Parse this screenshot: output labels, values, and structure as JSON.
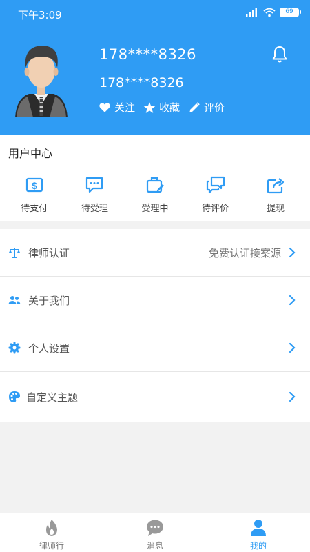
{
  "status_bar": {
    "time": "下午3:09",
    "battery": "69"
  },
  "profile": {
    "phone_primary": "178****8326",
    "phone_secondary": "178****8326",
    "actions": [
      {
        "label": "关注",
        "icon": "heart-icon"
      },
      {
        "label": "收藏",
        "icon": "star-icon"
      },
      {
        "label": "评价",
        "icon": "pencil-icon"
      }
    ]
  },
  "user_center": {
    "title": "用户中心",
    "items": [
      {
        "label": "待支付",
        "icon": "dollar-icon"
      },
      {
        "label": "待受理",
        "icon": "message-icon"
      },
      {
        "label": "受理中",
        "icon": "briefcase-icon"
      },
      {
        "label": "待评价",
        "icon": "chat-icon"
      },
      {
        "label": "提现",
        "icon": "share-icon"
      }
    ]
  },
  "menu": [
    {
      "label": "律师认证",
      "hint": "免费认证接案源",
      "icon": "scale-icon"
    },
    {
      "label": "关于我们",
      "hint": "",
      "icon": "people-icon"
    },
    {
      "label": "个人设置",
      "hint": "",
      "icon": "gear-icon"
    },
    {
      "label": "自定义主题",
      "hint": "",
      "icon": "palette-icon"
    }
  ],
  "tabs": [
    {
      "label": "律师行",
      "icon": "flame-icon",
      "active": false
    },
    {
      "label": "消息",
      "icon": "chat-bubble-icon",
      "active": false
    },
    {
      "label": "我的",
      "icon": "person-icon",
      "active": true
    }
  ],
  "colors": {
    "accent": "#2f9cf4",
    "tab_inactive": "#999999"
  }
}
